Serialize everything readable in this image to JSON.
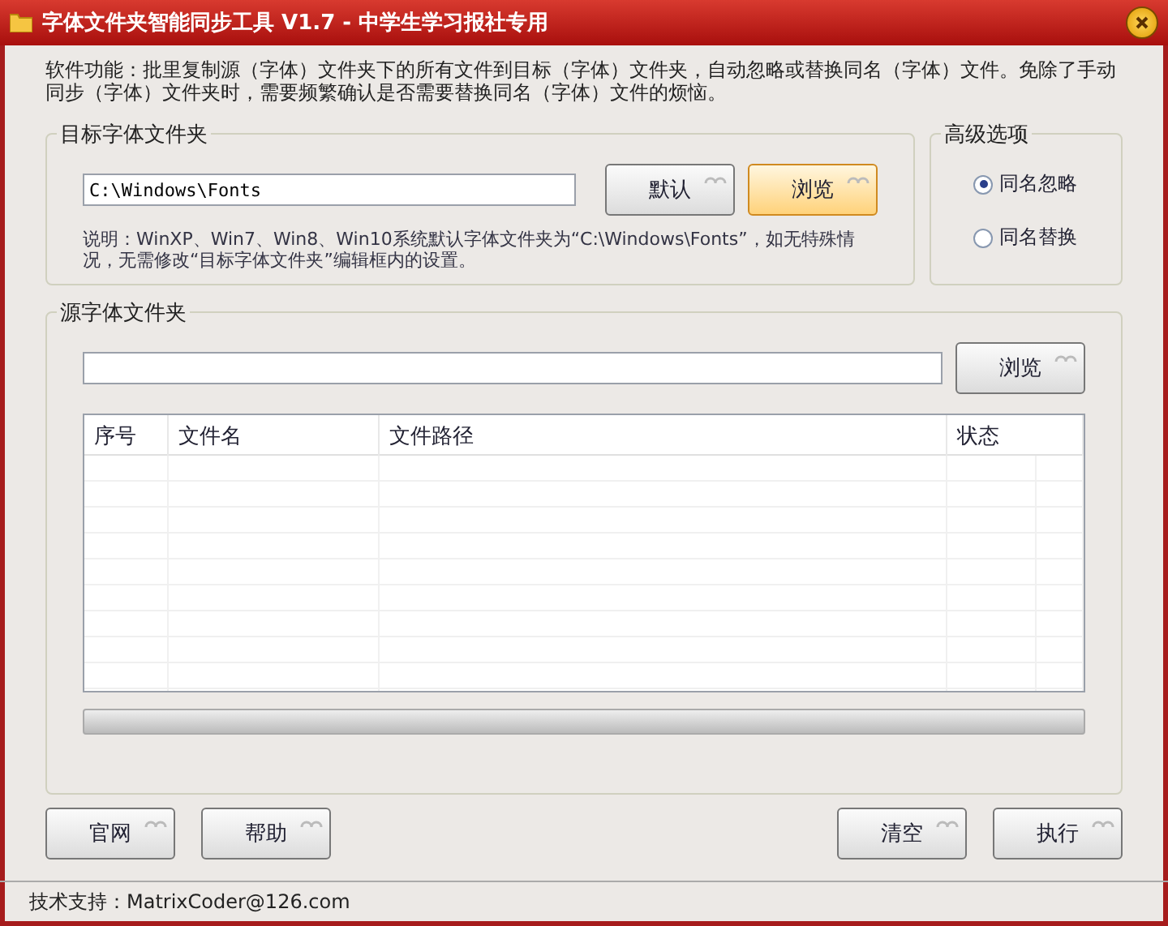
{
  "window": {
    "title": "字体文件夹智能同步工具 V1.7 - 中学生学习报社专用"
  },
  "description": "软件功能：批里复制源（字体）文件夹下的所有文件到目标（字体）文件夹，自动忽略或替换同名（字体）文件。免除了手动同步（字体）文件夹时，需要频繁确认是否需要替换同名（字体）文件的烦恼。",
  "target_group": {
    "title": "目标字体文件夹",
    "path_value": "C:\\Windows\\Fonts",
    "buttons": [
      {
        "label": "默认",
        "highlighted": false
      },
      {
        "label": "浏览",
        "highlighted": true
      }
    ],
    "note": "说明：WinXP、Win7、Win8、Win10系统默认字体文件夹为“C:\\Windows\\Fonts”，如无特殊情况，无需修改“目标字体文件夹”编辑框内的设置。"
  },
  "options_group": {
    "title": "高级选项",
    "radios": [
      {
        "label": "同名忽略",
        "selected": true
      },
      {
        "label": "同名替换",
        "selected": false
      }
    ]
  },
  "source_group": {
    "title": "源字体文件夹",
    "browse_button": {
      "label": "浏览",
      "highlighted": false
    },
    "table": {
      "columns": [
        "序号",
        "文件名",
        "文件路径",
        "状态"
      ]
    }
  },
  "buttons_left": [
    {
      "label": "官网",
      "highlighted": false
    },
    {
      "label": "帮助",
      "highlighted": false
    }
  ],
  "buttons_right": [
    {
      "label": "清空",
      "highlighted": false
    },
    {
      "label": "执行",
      "highlighted": false
    }
  ],
  "status_bar": "技术支持：MatrixCoder@126.com"
}
